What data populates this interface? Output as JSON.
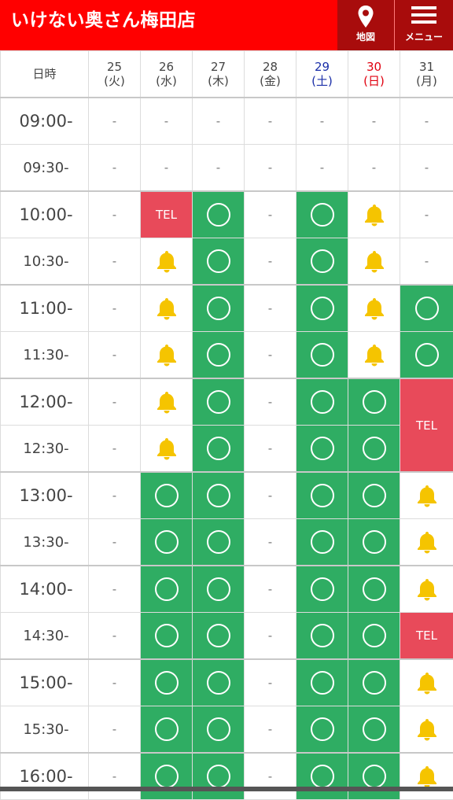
{
  "header": {
    "title": "いけない奥さん梅田店",
    "map_label": "地図",
    "menu_label": "メニュー",
    "bg": "#ff0000",
    "btn_bg": "#a80c0c"
  },
  "table": {
    "time_header": "日時",
    "days": [
      {
        "date": "25",
        "dow": "(火)",
        "kind": "weekday"
      },
      {
        "date": "26",
        "dow": "(水)",
        "kind": "weekday"
      },
      {
        "date": "27",
        "dow": "(木)",
        "kind": "weekday"
      },
      {
        "date": "28",
        "dow": "(金)",
        "kind": "weekday"
      },
      {
        "date": "29",
        "dow": "(土)",
        "kind": "sat"
      },
      {
        "date": "30",
        "dow": "(日)",
        "kind": "sun"
      },
      {
        "date": "31",
        "dow": "(月)",
        "kind": "weekday"
      }
    ],
    "legend": {
      "dash": "-",
      "tel": "TEL",
      "circle": "available-circle-icon",
      "bell": "bell-icon"
    },
    "colors": {
      "available": "#2fad63",
      "tel": "#e84a5a",
      "bell": "#f5c400",
      "sat": "#1a2ea8",
      "sun": "#e0000f"
    },
    "rows": [
      {
        "time": "09:00-",
        "hour": true,
        "cells": [
          "dash",
          "dash",
          "dash",
          "dash",
          "dash",
          "dash",
          "dash"
        ]
      },
      {
        "time": "09:30-",
        "hour": false,
        "cells": [
          "dash",
          "dash",
          "dash",
          "dash",
          "dash",
          "dash",
          "dash"
        ]
      },
      {
        "time": "10:00-",
        "hour": true,
        "cells": [
          "dash",
          "tel",
          "ok",
          "dash",
          "ok",
          "bell",
          "dash"
        ]
      },
      {
        "time": "10:30-",
        "hour": false,
        "cells": [
          "dash",
          "bell",
          "ok",
          "dash",
          "ok",
          "bell",
          "dash"
        ]
      },
      {
        "time": "11:00-",
        "hour": true,
        "cells": [
          "dash",
          "bell",
          "ok",
          "dash",
          "ok",
          "bell",
          "ok"
        ]
      },
      {
        "time": "11:30-",
        "hour": false,
        "cells": [
          "dash",
          "bell",
          "ok",
          "dash",
          "ok",
          "bell",
          "ok"
        ]
      },
      {
        "time": "12:00-",
        "hour": true,
        "cells": [
          "dash",
          "bell",
          "ok",
          "dash",
          "ok",
          "ok",
          "tel2"
        ]
      },
      {
        "time": "12:30-",
        "hour": false,
        "cells": [
          "dash",
          "bell",
          "ok",
          "dash",
          "ok",
          "ok",
          "skip"
        ]
      },
      {
        "time": "13:00-",
        "hour": true,
        "cells": [
          "dash",
          "ok",
          "ok",
          "dash",
          "ok",
          "ok",
          "bell"
        ]
      },
      {
        "time": "13:30-",
        "hour": false,
        "cells": [
          "dash",
          "ok",
          "ok",
          "dash",
          "ok",
          "ok",
          "bell"
        ]
      },
      {
        "time": "14:00-",
        "hour": true,
        "cells": [
          "dash",
          "ok",
          "ok",
          "dash",
          "ok",
          "ok",
          "bell"
        ]
      },
      {
        "time": "14:30-",
        "hour": false,
        "cells": [
          "dash",
          "ok",
          "ok",
          "dash",
          "ok",
          "ok",
          "tel"
        ]
      },
      {
        "time": "15:00-",
        "hour": true,
        "cells": [
          "dash",
          "ok",
          "ok",
          "dash",
          "ok",
          "ok",
          "bell"
        ]
      },
      {
        "time": "15:30-",
        "hour": false,
        "cells": [
          "dash",
          "ok",
          "ok",
          "dash",
          "ok",
          "ok",
          "bell"
        ]
      },
      {
        "time": "16:00-",
        "hour": true,
        "cells": [
          "dash",
          "ok",
          "ok",
          "dash",
          "ok",
          "ok",
          "bell"
        ]
      }
    ]
  }
}
